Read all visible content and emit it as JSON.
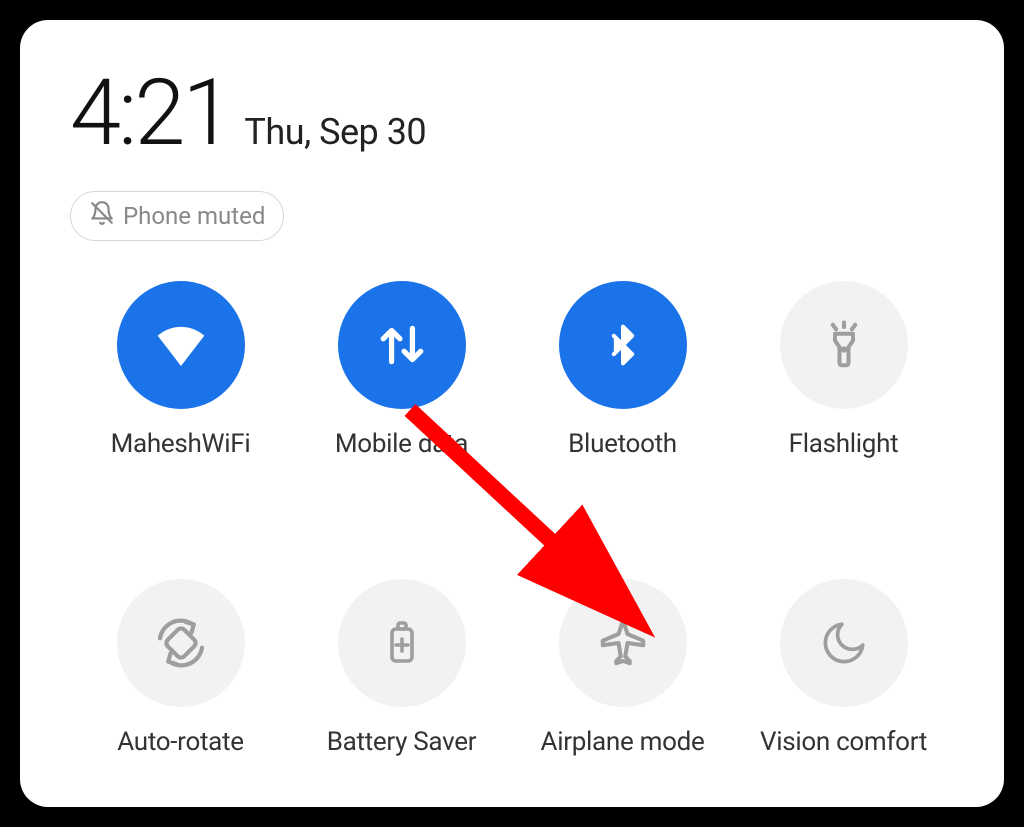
{
  "header": {
    "time": "4:21",
    "date": "Thu, Sep 30"
  },
  "chip": {
    "label": "Phone muted"
  },
  "toggles": {
    "wifi": {
      "label": "MaheshWiFi"
    },
    "mobile_data": {
      "label": "Mobile data"
    },
    "bluetooth": {
      "label": "Bluetooth"
    },
    "flashlight": {
      "label": "Flashlight"
    },
    "auto_rotate": {
      "label": "Auto-rotate"
    },
    "battery_saver": {
      "label": "Battery Saver"
    },
    "airplane_mode": {
      "label": "Airplane mode"
    },
    "vision_comfort": {
      "label": "Vision comfort"
    }
  },
  "colors": {
    "active": "#1a73e8",
    "inactive": "#f2f2f2",
    "arrow": "#ff0000"
  }
}
